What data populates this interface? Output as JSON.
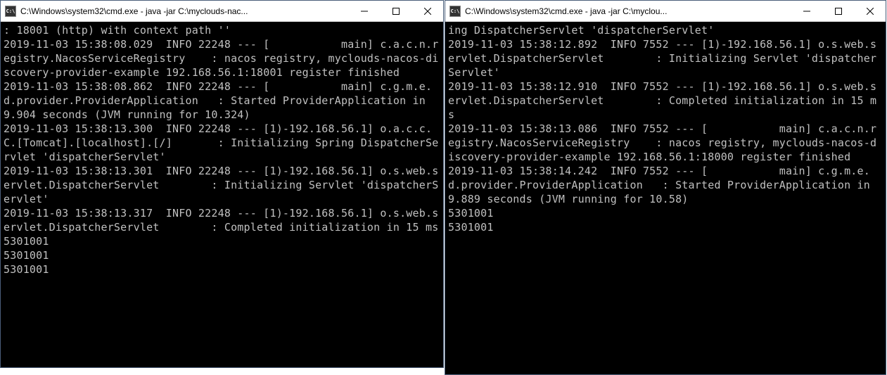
{
  "left": {
    "title": "C:\\Windows\\system32\\cmd.exe - java  -jar C:\\myclouds-nac...",
    "icon_label": "C:\\",
    "console": ": 18001 (http) with context path ''\n2019-11-03 15:38:08.029  INFO 22248 --- [           main] c.a.c.n.registry.NacosServiceRegistry    : nacos registry, myclouds-nacos-discovery-provider-example 192.168.56.1:18001 register finished\n2019-11-03 15:38:08.862  INFO 22248 --- [           main] c.g.m.e.d.provider.ProviderApplication   : Started ProviderApplication in 9.904 seconds (JVM running for 10.324)\n2019-11-03 15:38:13.300  INFO 22248 --- [1)-192.168.56.1] o.a.c.c.C.[Tomcat].[localhost].[/]       : Initializing Spring DispatcherServlet 'dispatcherServlet'\n2019-11-03 15:38:13.301  INFO 22248 --- [1)-192.168.56.1] o.s.web.servlet.DispatcherServlet        : Initializing Servlet 'dispatcherServlet'\n2019-11-03 15:38:13.317  INFO 22248 --- [1)-192.168.56.1] o.s.web.servlet.DispatcherServlet        : Completed initialization in 15 ms\n5301001\n5301001\n5301001"
  },
  "right": {
    "title": "C:\\Windows\\system32\\cmd.exe - java  -jar C:\\myclou...",
    "icon_label": "C:\\",
    "console": "ing DispatcherServlet 'dispatcherServlet'\n2019-11-03 15:38:12.892  INFO 7552 --- [1)-192.168.56.1] o.s.web.servlet.DispatcherServlet        : Initializing Servlet 'dispatcherServlet'\n2019-11-03 15:38:12.910  INFO 7552 --- [1)-192.168.56.1] o.s.web.servlet.DispatcherServlet        : Completed initialization in 15 ms\n2019-11-03 15:38:13.086  INFO 7552 --- [           main] c.a.c.n.registry.NacosServiceRegistry    : nacos registry, myclouds-nacos-discovery-provider-example 192.168.56.1:18000 register finished\n2019-11-03 15:38:14.242  INFO 7552 --- [           main] c.g.m.e.d.provider.ProviderApplication   : Started ProviderApplication in 9.889 seconds (JVM running for 10.58)\n5301001\n5301001"
  }
}
